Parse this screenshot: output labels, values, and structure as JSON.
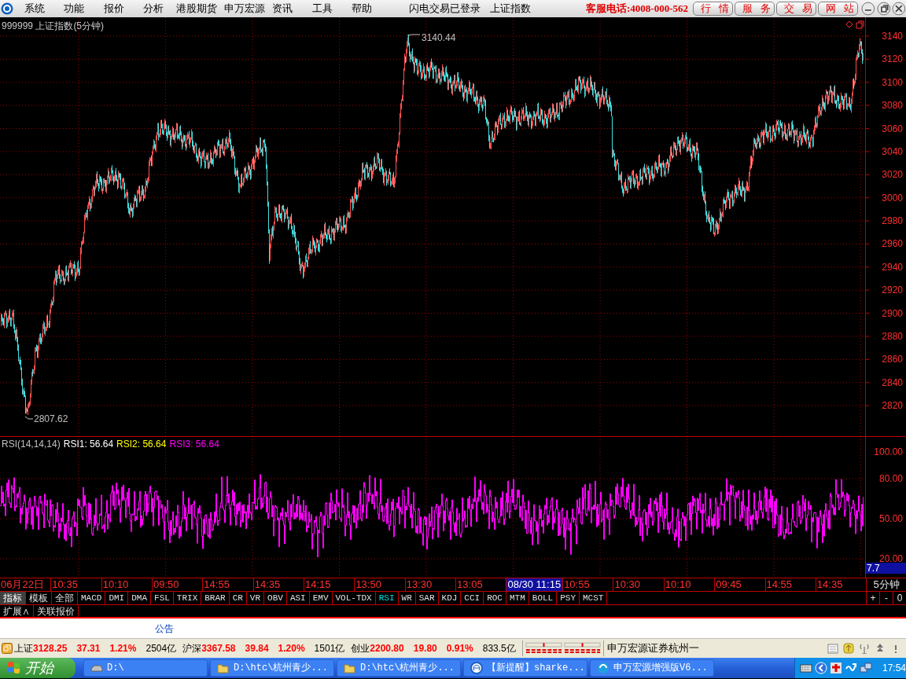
{
  "menu": {
    "items": [
      "系统",
      "功能",
      "报价",
      "分析",
      "港股期货",
      "申万宏源",
      "资讯",
      "工具",
      "帮助"
    ],
    "center": [
      "闪电交易已登录",
      "上证指数"
    ],
    "hotline": "客服电话:4008-000-562",
    "buttons": [
      "行情",
      "服务",
      "交易",
      "网站"
    ]
  },
  "chart": {
    "title": "999999 上证指数(5分钟)",
    "high_label": "3140.44",
    "low_label": "2807.62",
    "y_axis": [
      "3140",
      "3120",
      "3100",
      "3080",
      "3060",
      "3040",
      "3020",
      "3000",
      "2980",
      "2960",
      "2940",
      "2920",
      "2900",
      "2880",
      "2860",
      "2840",
      "2820"
    ]
  },
  "indicator": {
    "legend": [
      {
        "text": "RSI(14,14,14)",
        "color": "#c0c0c0"
      },
      {
        "text": "RSI1: 56.64",
        "color": "#ffffff"
      },
      {
        "text": "RSI2: 56.64",
        "color": "#ffff00"
      },
      {
        "text": "RSI3: 56.64",
        "color": "#ff00ff"
      }
    ],
    "y_axis": [
      "100.00",
      "80.00",
      "50.00",
      "20.00"
    ],
    "reading": "7.7"
  },
  "time_axis": {
    "labels": [
      {
        "text": "06月22日",
        "selected": false
      },
      {
        "text": "10:35",
        "selected": false
      },
      {
        "text": "10:10",
        "selected": false
      },
      {
        "text": "09:50",
        "selected": false
      },
      {
        "text": "14:55",
        "selected": false
      },
      {
        "text": "14:35",
        "selected": false
      },
      {
        "text": "14:15",
        "selected": false
      },
      {
        "text": "13:50",
        "selected": false
      },
      {
        "text": "13:30",
        "selected": false
      },
      {
        "text": "13:05",
        "selected": false
      },
      {
        "text": "08/30 11:15",
        "selected": true
      },
      {
        "text": "10:55",
        "selected": false
      },
      {
        "text": "10:30",
        "selected": false
      },
      {
        "text": "10:10",
        "selected": false
      },
      {
        "text": "09:45",
        "selected": false
      },
      {
        "text": "14:55",
        "selected": false
      },
      {
        "text": "14:35",
        "selected": false
      }
    ],
    "period": "5分钟"
  },
  "indicator_tabs": [
    {
      "label": "指标",
      "kind": "group",
      "selected": true
    },
    {
      "label": "模板",
      "kind": "group",
      "selected": false
    },
    {
      "label": "全部",
      "kind": "group",
      "selected": false
    },
    {
      "label": "MACD",
      "kind": "indicator",
      "selected": false
    },
    {
      "label": "DMI",
      "kind": "indicator",
      "selected": false
    },
    {
      "label": "DMA",
      "kind": "indicator",
      "selected": false
    },
    {
      "label": "FSL",
      "kind": "indicator",
      "selected": false
    },
    {
      "label": "TRIX",
      "kind": "indicator",
      "selected": false
    },
    {
      "label": "BRAR",
      "kind": "indicator",
      "selected": false
    },
    {
      "label": "CR",
      "kind": "indicator",
      "selected": false
    },
    {
      "label": "VR",
      "kind": "indicator",
      "selected": false
    },
    {
      "label": "OBV",
      "kind": "indicator",
      "selected": false
    },
    {
      "label": "ASI",
      "kind": "indicator",
      "selected": false
    },
    {
      "label": "EMV",
      "kind": "indicator",
      "selected": false
    },
    {
      "label": "VOL-TDX",
      "kind": "indicator",
      "selected": false
    },
    {
      "label": "RSI",
      "kind": "indicator",
      "selected": true
    },
    {
      "label": "WR",
      "kind": "indicator",
      "selected": false
    },
    {
      "label": "SAR",
      "kind": "indicator",
      "selected": false
    },
    {
      "label": "KDJ",
      "kind": "indicator",
      "selected": false
    },
    {
      "label": "CCI",
      "kind": "indicator",
      "selected": false
    },
    {
      "label": "ROC",
      "kind": "indicator",
      "selected": false
    },
    {
      "label": "MTM",
      "kind": "indicator",
      "selected": false
    },
    {
      "label": "BOLL",
      "kind": "indicator",
      "selected": false
    },
    {
      "label": "PSY",
      "kind": "indicator",
      "selected": false
    },
    {
      "label": "MCST",
      "kind": "indicator",
      "selected": false
    }
  ],
  "zoom_buttons": [
    "+",
    "-",
    "0"
  ],
  "extra_tabs": [
    "扩展∧",
    "关联报价"
  ],
  "notice": "公告",
  "status_bar": {
    "indices": [
      {
        "name": "上证",
        "value": "3128.25",
        "change": "37.31",
        "percent": "1.21%",
        "volume": "2504亿"
      },
      {
        "name": "沪深",
        "value": "3367.58",
        "change": "39.84",
        "percent": "1.20%",
        "volume": "1501亿"
      },
      {
        "name": "创业",
        "value": "2200.80",
        "change": "19.80",
        "percent": "0.91%",
        "volume": "833.5亿"
      }
    ],
    "broker": "申万宏源证券杭州一"
  },
  "taskbar": {
    "start": "开始",
    "tasks": [
      {
        "label": "D:\\",
        "kind": "drive"
      },
      {
        "label": "D:\\htc\\杭州青少...",
        "kind": "folder"
      },
      {
        "label": "D:\\htc\\杭州青少...",
        "kind": "folder"
      },
      {
        "label": "【新提醒】sharke...",
        "kind": "browser"
      },
      {
        "label": "申万宏源增强版V6...",
        "kind": "app"
      }
    ],
    "clock": "17:54"
  }
}
